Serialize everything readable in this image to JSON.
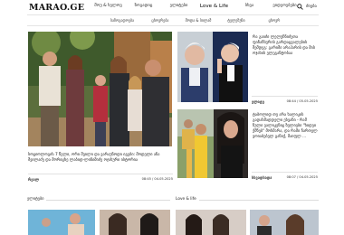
{
  "header": {
    "logo": "MARAO.GE",
    "nav": [
      "შოუ & ხელოვ",
      "ზოგადიც",
      "ელიტები",
      "Love & Life",
      "სხვა",
      "ვიდეოებები"
    ],
    "search_label": "ძიება"
  },
  "subnav": [
    "საზოგადოება",
    "ცხოვრება",
    "მოდა & სილამ",
    "ტელეზუნი",
    "ცხოვრ"
  ],
  "hero": {
    "headline": "სოციოლოგის 7 წელი, ორი შვილი და ვარაუნოდი იგები: მოდელი ანა შვილაძე და მორიცხე ლაბიდ-ლიჩიმიძე ოჯახური ისტორია",
    "tag": "რეალ",
    "date": "08:45 / 04.05.2025"
  },
  "card1": {
    "headline": "რა გაიძი ლელუჩნიძეთა ფინანსურის გარდაცვალების შემდეგ: გარიში არაპარის და მის ოჯახის ელეგანტობაა",
    "tag": "ელიტე",
    "date": "08:44 / 05.05.2025"
  },
  "card2": {
    "headline": "ტაბოლიდ თუ არა ხალიკის გადახმადდელი ეხვანი - რამ ნული ვალიკენიც ზულიები \"ხიდეი ქმნებ\" მოხმარა, და რამი ჩართელ ვოიაბებელ განიქ, მაიფლ ...",
    "tag": "სხვადსადა",
    "date": "08:07 / 04.05.2025"
  },
  "sections": {
    "left": "ელიტები",
    "right": "Love & life"
  }
}
